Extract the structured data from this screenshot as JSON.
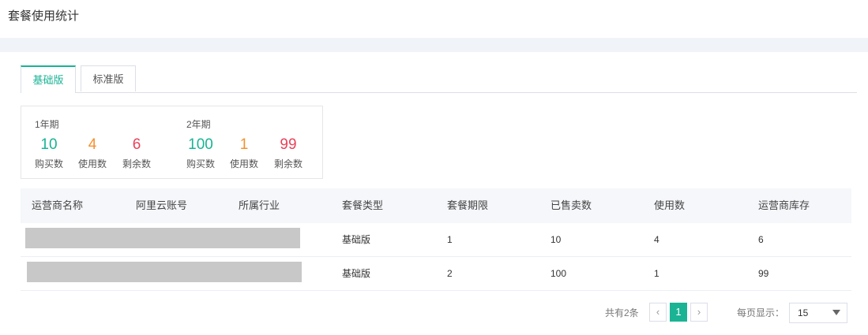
{
  "page": {
    "title": "套餐使用统计"
  },
  "tabs": [
    {
      "label": "基础版",
      "active": true
    },
    {
      "label": "标准版",
      "active": false
    }
  ],
  "stats": [
    {
      "period": "1年期",
      "items": [
        {
          "value": "10",
          "label": "购买数",
          "color": "#1ab394"
        },
        {
          "value": "4",
          "label": "使用数",
          "color": "#f4912f"
        },
        {
          "value": "6",
          "label": "剩余数",
          "color": "#e8425b"
        }
      ]
    },
    {
      "period": "2年期",
      "items": [
        {
          "value": "100",
          "label": "购买数",
          "color": "#1ab394"
        },
        {
          "value": "1",
          "label": "使用数",
          "color": "#f4912f"
        },
        {
          "value": "99",
          "label": "剩余数",
          "color": "#e8425b"
        }
      ]
    }
  ],
  "table": {
    "headers": [
      "运营商名称",
      "阿里云账号",
      "所属行业",
      "套餐类型",
      "套餐期限",
      "已售卖数",
      "使用数",
      "运营商库存"
    ],
    "rows": [
      {
        "name": "",
        "account": "",
        "industry": "",
        "package_type": "基础版",
        "term": "1",
        "sold": "10",
        "used": "4",
        "stock": "6"
      },
      {
        "name": "",
        "account": "",
        "industry": "",
        "package_type": "基础版",
        "term": "2",
        "sold": "100",
        "used": "1",
        "stock": "99"
      }
    ]
  },
  "pagination": {
    "total_text": "共有2条",
    "prev_icon": "chevron-left-icon",
    "current_page": "1",
    "next_icon": "chevron-right-icon",
    "per_page_label": "每页显示：",
    "per_page_value": "15"
  },
  "colors": {
    "accent": "#1ab394",
    "orange": "#f4912f",
    "red": "#e8425b"
  }
}
